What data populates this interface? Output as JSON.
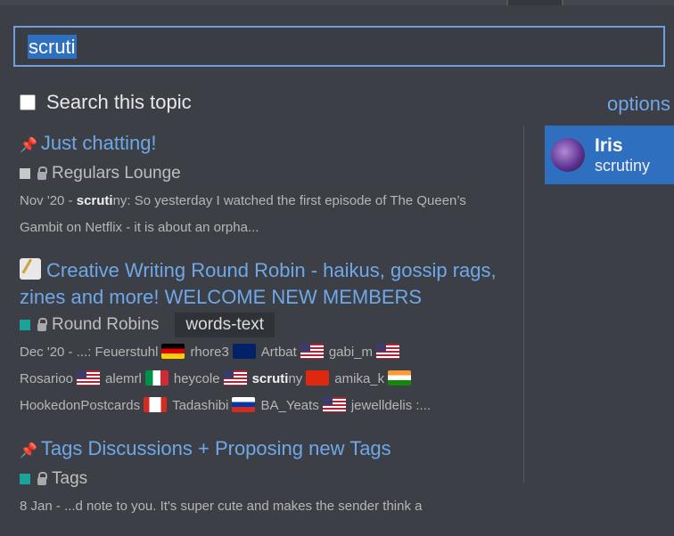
{
  "search": {
    "value": "scruti"
  },
  "search_this_topic": "Search this topic",
  "options_label": "options",
  "results": [
    {
      "title": "Just chatting!",
      "pinned": true,
      "category": "Regulars Lounge",
      "category_color": "#c8c8c8",
      "date": "Nov '20",
      "blurb_pre": " - ",
      "blurb_bold": "scruti",
      "blurb_post": "ny: So yesterday I watched the first episode of The Queen’s Gambit on Netflix - it is about an orpha..."
    },
    {
      "title": "Creative Writing Round Robin - haikus, gossip rags, zines and more! WELCOME NEW MEMBERS",
      "emoji": "memo-icon",
      "category": "Round Robins",
      "category_color": "#1aa39a",
      "tag": "words-text",
      "date": "Dec '20",
      "line1": [
        " - ...: Feuerstuhl",
        "rhore3",
        "Artbat",
        "gabi_m"
      ],
      "line2_a": "Rosarioo",
      "line2_b": "alemrl",
      "line2_c": "heycole",
      "line2_bold": "scruti",
      "line2_post": "ny",
      "line2_d": "amika_k",
      "line3": [
        "HookedonPostcards",
        "Tadashibi",
        "BA_Yeats",
        "jewelldelis :..."
      ]
    },
    {
      "title": "Tags Discussions + Proposing new Tags",
      "pinned": true,
      "category": "Tags",
      "category_color": "#1aa39a",
      "date": "8 Jan",
      "blurb": " - ...d note to you. It's super cute and makes the sender think a"
    }
  ],
  "user": {
    "name": "Iris",
    "username": "scrutiny"
  }
}
